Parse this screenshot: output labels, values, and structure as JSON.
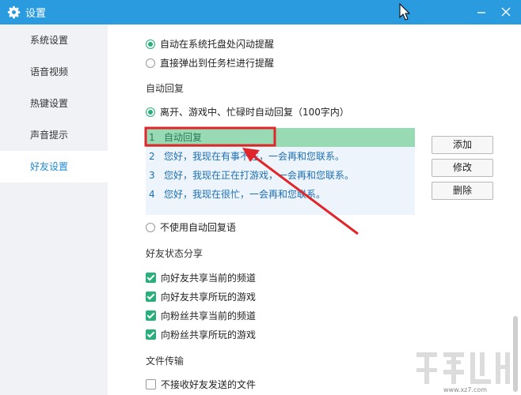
{
  "window": {
    "title": "设置"
  },
  "sidebar": {
    "items": [
      {
        "label": "系统设置",
        "active": false
      },
      {
        "label": "语音视频",
        "active": false
      },
      {
        "label": "热键设置",
        "active": false
      },
      {
        "label": "声音提示",
        "active": false
      },
      {
        "label": "好友设置",
        "active": true
      }
    ]
  },
  "notify": {
    "option_tray_flash": "自动在系统托盘处闪动提醒",
    "option_taskbar_popup": "直接弹出到任务栏进行提醒",
    "selected": "option_tray_flash"
  },
  "auto_reply": {
    "section_title": "自动回复",
    "option_enable": "离开、游戏中、忙碌时自动回复（100字内）",
    "option_disable": "不使用自动回复语",
    "selected": "option_enable",
    "items": [
      {
        "num": "1",
        "text": "自动回复",
        "selected": true
      },
      {
        "num": "2",
        "text": "您好，我现在有事不在，一会再和您联系。",
        "selected": false
      },
      {
        "num": "3",
        "text": "您好，我现在正在打游戏，一会再和您联系。",
        "selected": false
      },
      {
        "num": "4",
        "text": "您好，我现在很忙，一会再和您联系。",
        "selected": false
      }
    ],
    "buttons": {
      "add": "添加",
      "edit": "修改",
      "delete": "删除"
    }
  },
  "friend_status": {
    "section_title": "好友状态分享",
    "options": [
      {
        "label": "向好友共享当前的频道",
        "checked": true
      },
      {
        "label": "向好友共享所玩的游戏",
        "checked": true
      },
      {
        "label": "向粉丝共享当前的频道",
        "checked": true
      },
      {
        "label": "向粉丝共享所玩的游戏",
        "checked": true
      }
    ]
  },
  "file_transfer": {
    "section_title": "文件传输",
    "option_reject": "不接收好友发送的文件",
    "checked": false
  },
  "watermark": {
    "text": "www.xz7.com"
  },
  "colors": {
    "titlebar": "#2b9be0",
    "accent_green": "#29b07a",
    "selected_row": "#97dab4",
    "reply_list_bg": "#eef4fb",
    "annotation_red": "#e0262a"
  },
  "icons": {
    "title": "gear-icon",
    "minimize": "minimize-icon",
    "close": "close-icon"
  }
}
